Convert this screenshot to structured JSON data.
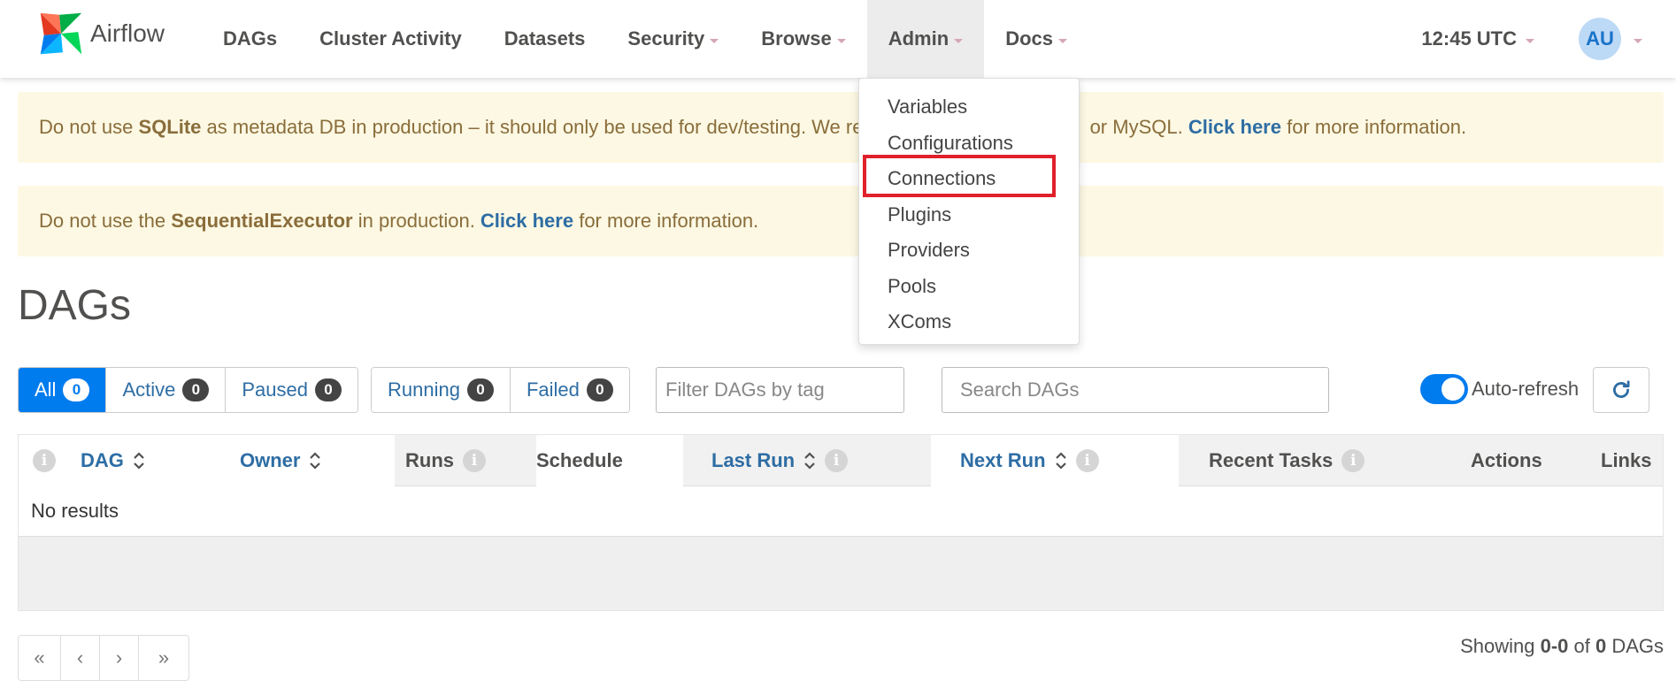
{
  "brand": {
    "name": "Airflow"
  },
  "nav": {
    "items": [
      {
        "label": "DAGs"
      },
      {
        "label": "Cluster Activity"
      },
      {
        "label": "Datasets"
      },
      {
        "label": "Security"
      },
      {
        "label": "Browse"
      },
      {
        "label": "Admin"
      },
      {
        "label": "Docs"
      }
    ],
    "clock": "12:45 UTC",
    "user_initials": "AU"
  },
  "admin_menu": {
    "items": [
      {
        "label": "Variables"
      },
      {
        "label": "Configurations"
      },
      {
        "label": "Connections"
      },
      {
        "label": "Plugins"
      },
      {
        "label": "Providers"
      },
      {
        "label": "Pools"
      },
      {
        "label": "XComs"
      }
    ],
    "highlighted": "Connections"
  },
  "alerts": {
    "sqlite": {
      "pre": "Do not use ",
      "bold": "SQLite",
      "mid": " as metadata DB in production – it should only be used for dev/testing. We re",
      "post": " or MySQL. ",
      "link": "Click here",
      "tail": " for more information."
    },
    "executor": {
      "pre": "Do not use the ",
      "bold": "SequentialExecutor",
      "mid": " in production. ",
      "link": "Click here",
      "tail": " for more information."
    }
  },
  "page_title": "DAGs",
  "filters": {
    "status": [
      {
        "label": "All",
        "count": "0",
        "active": true
      },
      {
        "label": "Active",
        "count": "0"
      },
      {
        "label": "Paused",
        "count": "0"
      }
    ],
    "run_state": [
      {
        "label": "Running",
        "count": "0"
      },
      {
        "label": "Failed",
        "count": "0"
      }
    ],
    "tag_placeholder": "Filter DAGs by tag",
    "search_placeholder": "Search DAGs",
    "auto_refresh_label": "Auto-refresh"
  },
  "table": {
    "columns": {
      "dag": "DAG",
      "owner": "Owner",
      "runs": "Runs",
      "schedule": "Schedule",
      "last_run": "Last Run",
      "next_run": "Next Run",
      "recent_tasks": "Recent Tasks",
      "actions": "Actions",
      "links": "Links"
    },
    "empty_text": "No results"
  },
  "pagination": {
    "first": "«",
    "prev": "‹",
    "next": "›",
    "last": "»",
    "showing_pre": "Showing ",
    "range": "0-0",
    "of": " of ",
    "total": "0",
    "suffix": " DAGs"
  },
  "colors": {
    "primary": "#017cee",
    "link": "#2e6da4",
    "alert_bg": "#fcf8e3",
    "alert_text": "#8a6d3b",
    "highlight": "#e0202a"
  }
}
